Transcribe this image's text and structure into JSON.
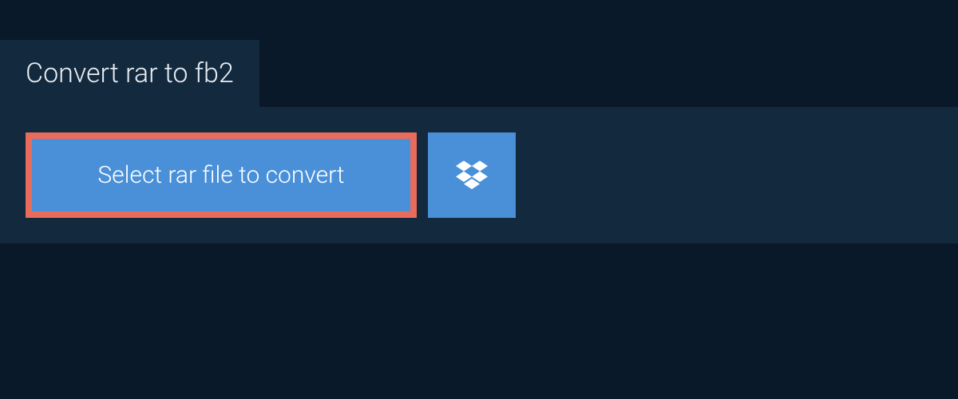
{
  "tab": {
    "title": "Convert rar to fb2"
  },
  "actions": {
    "select_file_label": "Select rar file to convert"
  }
}
